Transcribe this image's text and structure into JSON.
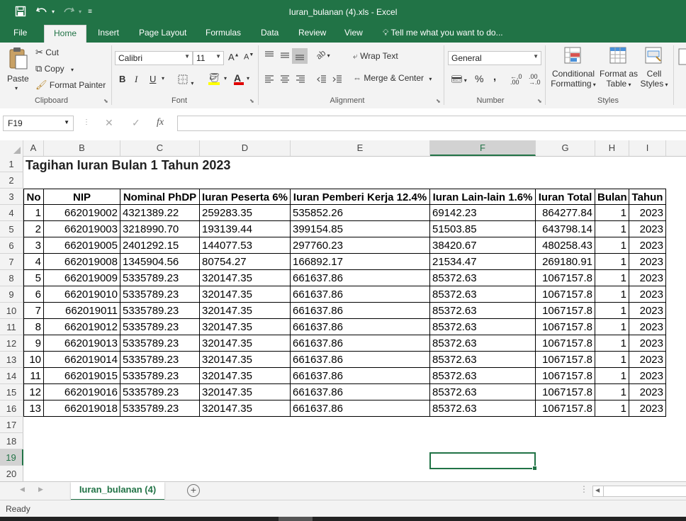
{
  "window": {
    "title": "Iuran_bulanan (4).xls - Excel",
    "accent_color": "#217346",
    "quick_access": [
      "save-icon",
      "undo-icon",
      "redo-icon",
      "customize-icon"
    ]
  },
  "tabs": [
    {
      "label": "File"
    },
    {
      "label": "Home",
      "active": true
    },
    {
      "label": "Insert"
    },
    {
      "label": "Page Layout"
    },
    {
      "label": "Formulas"
    },
    {
      "label": "Data"
    },
    {
      "label": "Review"
    },
    {
      "label": "View"
    },
    {
      "label": "Tell me what you want to do..."
    }
  ],
  "ribbon": {
    "clipboard": {
      "paste": "Paste",
      "cut": "Cut",
      "copy": "Copy",
      "format_painter": "Format Painter",
      "group": "Clipboard"
    },
    "font": {
      "name": "Calibri",
      "size": "11",
      "bold": "B",
      "italic": "I",
      "underline": "U",
      "group": "Font"
    },
    "alignment": {
      "wrap_text": "Wrap Text",
      "merge_center": "Merge & Center",
      "group": "Alignment"
    },
    "number": {
      "format": "General",
      "percent": "%",
      "comma": ",",
      "group": "Number"
    },
    "styles": {
      "conditional": "Conditional",
      "conditional2": "Formatting",
      "format_as": "Format as",
      "format_as2": "Table",
      "cell": "Cell",
      "cell2": "Styles",
      "group": "Styles"
    }
  },
  "formula_bar": {
    "name_box": "F19",
    "cancel": "✕",
    "enter": "✓",
    "fx": "fx",
    "content": ""
  },
  "columns": [
    "A",
    "B",
    "C",
    "D",
    "E",
    "F",
    "G",
    "H",
    "I"
  ],
  "selected_column": "F",
  "rows": [
    "1",
    "2",
    "3",
    "4",
    "5",
    "6",
    "7",
    "8",
    "9",
    "10",
    "11",
    "12",
    "13",
    "14",
    "15",
    "16",
    "17",
    "18",
    "19",
    "20"
  ],
  "selected_row": "19",
  "sheet": {
    "title": "Tagihan Iuran Bulan 1 Tahun 2023",
    "headers": [
      "No",
      "NIP",
      "Nominal PhDP",
      "Iuran Peserta 6%",
      "Iuran Pemberi Kerja 12.4%",
      "Iuran Lain-lain 1.6%",
      "Iuran Total",
      "Bulan",
      "Tahun"
    ],
    "data": [
      [
        "1",
        "662019002",
        "4321389.22",
        "259283.35",
        "535852.26",
        "69142.23",
        "864277.84",
        "1",
        "2023"
      ],
      [
        "2",
        "662019003",
        "3218990.70",
        "193139.44",
        "399154.85",
        "51503.85",
        "643798.14",
        "1",
        "2023"
      ],
      [
        "3",
        "662019005",
        "2401292.15",
        "144077.53",
        "297760.23",
        "38420.67",
        "480258.43",
        "1",
        "2023"
      ],
      [
        "4",
        "662019008",
        "1345904.56",
        "80754.27",
        "166892.17",
        "21534.47",
        "269180.91",
        "1",
        "2023"
      ],
      [
        "5",
        "662019009",
        "5335789.23",
        "320147.35",
        "661637.86",
        "85372.63",
        "1067157.8",
        "1",
        "2023"
      ],
      [
        "6",
        "662019010",
        "5335789.23",
        "320147.35",
        "661637.86",
        "85372.63",
        "1067157.8",
        "1",
        "2023"
      ],
      [
        "7",
        "662019011",
        "5335789.23",
        "320147.35",
        "661637.86",
        "85372.63",
        "1067157.8",
        "1",
        "2023"
      ],
      [
        "8",
        "662019012",
        "5335789.23",
        "320147.35",
        "661637.86",
        "85372.63",
        "1067157.8",
        "1",
        "2023"
      ],
      [
        "9",
        "662019013",
        "5335789.23",
        "320147.35",
        "661637.86",
        "85372.63",
        "1067157.8",
        "1",
        "2023"
      ],
      [
        "10",
        "662019014",
        "5335789.23",
        "320147.35",
        "661637.86",
        "85372.63",
        "1067157.8",
        "1",
        "2023"
      ],
      [
        "11",
        "662019015",
        "5335789.23",
        "320147.35",
        "661637.86",
        "85372.63",
        "1067157.8",
        "1",
        "2023"
      ],
      [
        "12",
        "662019016",
        "5335789.23",
        "320147.35",
        "661637.86",
        "85372.63",
        "1067157.8",
        "1",
        "2023"
      ],
      [
        "13",
        "662019018",
        "5335789.23",
        "320147.35",
        "661637.86",
        "85372.63",
        "1067157.8",
        "1",
        "2023"
      ]
    ]
  },
  "sheet_tab": "Iuran_bulanan (4)",
  "status": "Ready"
}
